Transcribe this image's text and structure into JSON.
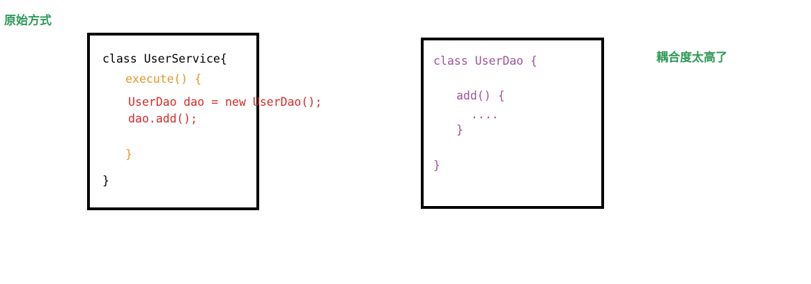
{
  "colors": {
    "label_green": "#2e9a57",
    "black": "#000000",
    "orange": "#e8962a",
    "red": "#d42a2a",
    "purple": "#a0529e"
  },
  "labels": {
    "original_approach": "原始方式",
    "coupling_too_high": "耦合度太高了"
  },
  "user_service": {
    "class_decl": "class UserService{",
    "method_decl": "execute() {",
    "line_new": "UserDao dao = new UserDao();",
    "line_call": "dao.add();",
    "method_close": "}",
    "class_close": "}"
  },
  "user_dao": {
    "class_decl": "class UserDao {",
    "method_decl": "add() {",
    "method_body": "....",
    "method_close": "}",
    "class_close": "}"
  }
}
